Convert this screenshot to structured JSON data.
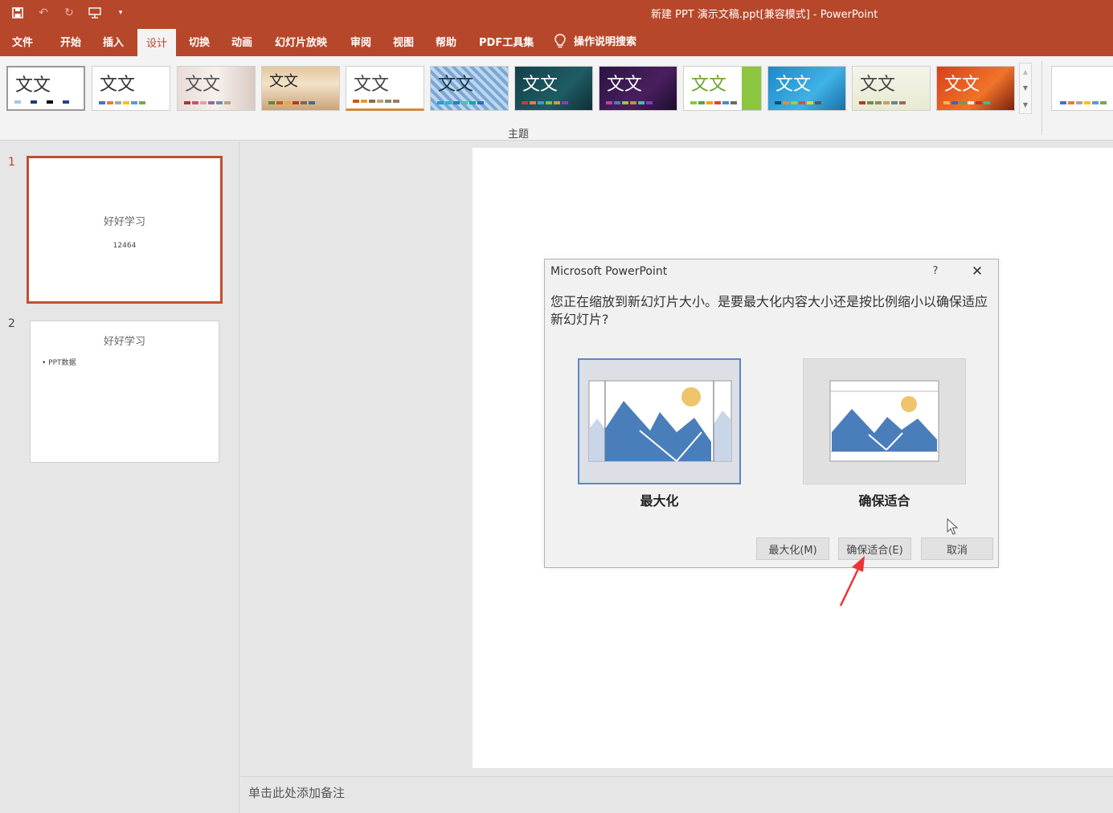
{
  "window": {
    "title": "新建 PPT 演示文稿.ppt[兼容模式]  -  PowerPoint",
    "theme_color": "#b7472a"
  },
  "quick_access": {
    "icons": [
      "save-icon",
      "undo-icon",
      "redo-icon",
      "presenter-icon",
      "customize-icon"
    ]
  },
  "ribbon": {
    "tabs": [
      {
        "label": "文件",
        "active": false
      },
      {
        "label": "开始",
        "active": false
      },
      {
        "label": "插入",
        "active": false
      },
      {
        "label": "设计",
        "active": true
      },
      {
        "label": "切换",
        "active": false
      },
      {
        "label": "动画",
        "active": false
      },
      {
        "label": "幻灯片放映",
        "active": false
      },
      {
        "label": "审阅",
        "active": false
      },
      {
        "label": "视图",
        "active": false
      },
      {
        "label": "帮助",
        "active": false
      },
      {
        "label": "PDF工具集",
        "active": false
      }
    ],
    "tell_me": "操作说明搜索",
    "themes_group_label": "主题",
    "theme_glyph": "文文"
  },
  "slides": [
    {
      "number": "1",
      "title": "好好学习",
      "subtitle": "12464",
      "selected": true
    },
    {
      "number": "2",
      "title": "好好学习",
      "bullet": "• PPT数据",
      "selected": false
    }
  ],
  "notes_placeholder": "单击此处添加备注",
  "dialog": {
    "title": "Microsoft PowerPoint",
    "help": "?",
    "message": "您正在缩放到新幻灯片大小。是要最大化内容大小还是按比例缩小以确保适应新幻灯片?",
    "options": [
      {
        "label": "最大化",
        "selected": true
      },
      {
        "label": "确保适合",
        "selected": false
      }
    ],
    "buttons": {
      "maximize": "最大化(M)",
      "ensure_fit": "确保适合(E)",
      "cancel": "取消"
    }
  }
}
